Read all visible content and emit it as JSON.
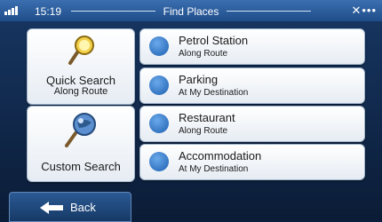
{
  "status": {
    "time": "15:19",
    "title": "Find Places",
    "right_icons": "✕•••"
  },
  "tiles": {
    "quick_search": {
      "line1": "Quick Search",
      "line2": "Along Route",
      "icon": "magnifier-icon"
    },
    "custom_search": {
      "line1": "Custom Search",
      "icon": "search-globe-icon"
    }
  },
  "places": [
    {
      "name": "Petrol Station",
      "sub": "Along Route",
      "icon": "fuel-icon"
    },
    {
      "name": "Parking",
      "sub": "At My Destination",
      "icon": "parking-icon"
    },
    {
      "name": "Restaurant",
      "sub": "Along Route",
      "icon": "restaurant-icon"
    },
    {
      "name": "Accommodation",
      "sub": "At My Destination",
      "icon": "bed-icon"
    }
  ],
  "back_label": "Back"
}
